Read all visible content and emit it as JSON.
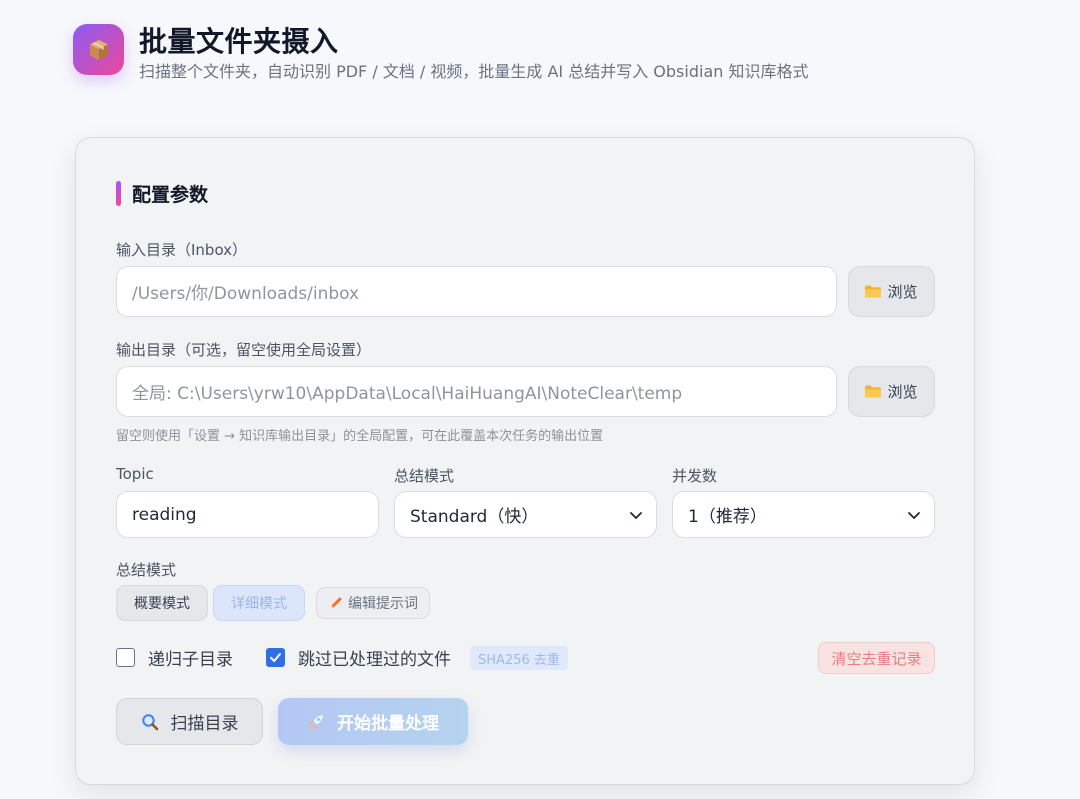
{
  "header": {
    "title": "批量文件夹摄入",
    "subtitle": "扫描整个文件夹，自动识别 PDF / 文档 / 视频，批量生成 AI 总结并写入 Obsidian 知识库格式",
    "logo_icon": "package-icon"
  },
  "config": {
    "section_title": "配置参数",
    "input_dir": {
      "label": "输入目录（Inbox）",
      "placeholder": "/Users/你/Downloads/inbox",
      "value": ""
    },
    "output_dir": {
      "label": "输出目录（可选，留空使用全局设置）",
      "placeholder": "全局: C:\\Users\\yrw10\\AppData\\Local\\HaiHuangAI\\NoteClear\\temp",
      "value": ""
    },
    "browse_label": "浏览",
    "output_hint": "留空则使用「设置 → 知识库输出目录」的全局配置，可在此覆盖本次任务的输出位置",
    "topic": {
      "label": "Topic",
      "value": "reading"
    },
    "summary_mode_select": {
      "label": "总结模式",
      "value": "Standard（快）"
    },
    "concurrency": {
      "label": "并发数",
      "value": "1（推荐）"
    },
    "summary_mode_chips": {
      "label": "总结模式",
      "brief": "概要模式",
      "detailed": "详细模式",
      "edit_prompt": "编辑提示词"
    },
    "recursive": {
      "label": "递归子目录",
      "checked": false
    },
    "skip_processed": {
      "label": "跳过已处理过的文件",
      "checked": true,
      "badge": "SHA256 去重"
    },
    "clear_dedupe": "清空去重记录",
    "scan_button": "扫描目录",
    "start_button": "开始批量处理"
  },
  "colors": {
    "accent_gradient_start": "#a855f7",
    "accent_gradient_end": "#ec4899",
    "checkbox_checked": "#2f6fe4",
    "danger_text": "#e58080"
  }
}
